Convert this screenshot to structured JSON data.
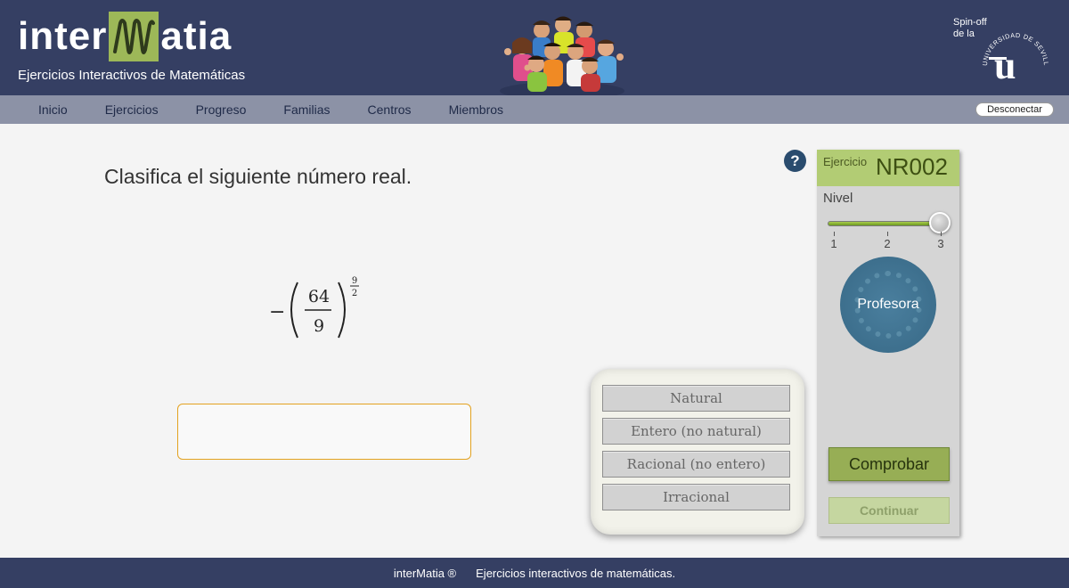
{
  "header": {
    "logo_left": "inter",
    "logo_right": "atia",
    "tagline": "Ejercicios Interactivos de Matemáticas",
    "spinoff_line1": "Spin-off",
    "spinoff_line2": "de la",
    "university": "UNIVERSIDAD DE SEVILLA",
    "colors": {
      "header_bg": "#353f63",
      "logo_accent": "#9db858"
    }
  },
  "nav": {
    "items": [
      {
        "label": "Inicio"
      },
      {
        "label": "Ejercicios"
      },
      {
        "label": "Progreso"
      },
      {
        "label": "Familias"
      },
      {
        "label": "Centros"
      },
      {
        "label": "Miembros"
      }
    ],
    "disconnect_label": "Desconectar"
  },
  "exercise": {
    "question": "Clasifica el siguiente número real.",
    "expression": {
      "sign": "−",
      "numerator": "64",
      "denominator": "9",
      "exponent_numerator": "9",
      "exponent_denominator": "2"
    },
    "answer_value": "",
    "options": [
      {
        "label": "Natural"
      },
      {
        "label": "Entero (no natural)"
      },
      {
        "label": "Racional (no entero)"
      },
      {
        "label": "Irracional"
      }
    ]
  },
  "sidebar": {
    "help_icon": "?",
    "exercise_label": "Ejercicio",
    "exercise_code": "NR002",
    "level_label": "Nivel",
    "level_value": 3,
    "level_ticks": [
      "1",
      "2",
      "3"
    ],
    "teacher_label": "Profesora",
    "check_label": "Comprobar",
    "continue_label": "Continuar"
  },
  "footer": {
    "brand": "interMatia ®",
    "description": "Ejercicios interactivos de matemáticas."
  }
}
